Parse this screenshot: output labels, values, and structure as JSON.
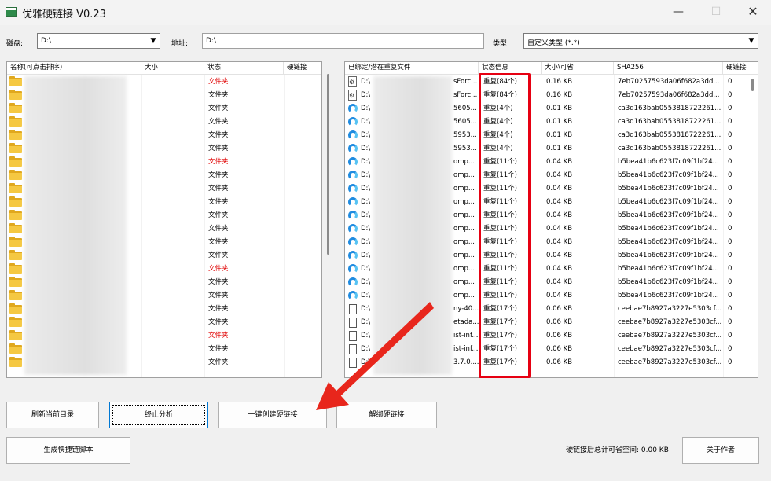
{
  "window": {
    "title": "优雅硬链接 V0.23",
    "controls": [
      "—",
      "☐",
      "✕"
    ]
  },
  "toolbar": {
    "disk_label": "磁盘:",
    "disk_value": "D:\\",
    "address_label": "地址:",
    "address_value": "D:\\",
    "type_label": "类型:",
    "type_value": "自定义类型 (*.*)"
  },
  "left_table": {
    "columns": [
      "名称(可点击排序)",
      "大小",
      "状态",
      "硬链接"
    ],
    "rows": [
      {
        "status": "文件夹",
        "red": true
      },
      {
        "status": "文件夹",
        "red": false
      },
      {
        "status": "文件夹",
        "red": false
      },
      {
        "status": "文件夹",
        "red": false
      },
      {
        "status": "文件夹",
        "red": false
      },
      {
        "status": "文件夹",
        "red": false
      },
      {
        "status": "文件夹",
        "red": true
      },
      {
        "status": "文件夹",
        "red": false
      },
      {
        "status": "文件夹",
        "red": false
      },
      {
        "status": "文件夹",
        "red": false
      },
      {
        "status": "文件夹",
        "red": false
      },
      {
        "status": "文件夹",
        "red": false
      },
      {
        "status": "文件夹",
        "red": false
      },
      {
        "status": "文件夹",
        "red": false
      },
      {
        "status": "文件夹",
        "red": true
      },
      {
        "status": "文件夹",
        "red": false
      },
      {
        "status": "文件夹",
        "red": false
      },
      {
        "status": "文件夹",
        "red": false
      },
      {
        "status": "文件夹",
        "red": false
      },
      {
        "status": "文件夹",
        "red": true
      },
      {
        "status": "文件夹",
        "red": false
      },
      {
        "status": "文件夹",
        "red": false
      }
    ]
  },
  "right_table": {
    "columns": [
      "已绑定/潜在重复文件",
      "状态信息",
      "大小\\可省",
      "SHA256",
      "硬链接"
    ],
    "rows": [
      {
        "icon": "gear-file-icon",
        "path": "D:\\",
        "tail": "sForc...",
        "status": "重复(84个)",
        "size": "0.16 KB",
        "sha": "7eb70257593da06f682a3dd...",
        "link": "0"
      },
      {
        "icon": "gear-file-icon",
        "path": "D:\\",
        "tail": "sForc...",
        "status": "重复(84个)",
        "size": "0.16 KB",
        "sha": "7eb70257593da06f682a3dd...",
        "link": "0"
      },
      {
        "icon": "edge-icon",
        "path": "D:\\",
        "tail": "5605...",
        "status": "重复(4个)",
        "size": "0.01 KB",
        "sha": "ca3d163bab0553818722261...",
        "link": "0"
      },
      {
        "icon": "edge-icon",
        "path": "D:\\",
        "tail": "5605...",
        "status": "重复(4个)",
        "size": "0.01 KB",
        "sha": "ca3d163bab0553818722261...",
        "link": "0"
      },
      {
        "icon": "edge-icon",
        "path": "D:\\",
        "tail": "5953...",
        "status": "重复(4个)",
        "size": "0.01 KB",
        "sha": "ca3d163bab0553818722261...",
        "link": "0"
      },
      {
        "icon": "edge-icon",
        "path": "D:\\",
        "tail": "5953...",
        "status": "重复(4个)",
        "size": "0.01 KB",
        "sha": "ca3d163bab0553818722261...",
        "link": "0"
      },
      {
        "icon": "edge-icon",
        "path": "D:\\",
        "tail": "omp...",
        "status": "重复(11个)",
        "size": "0.04 KB",
        "sha": "b5bea41b6c623f7c09f1bf24...",
        "link": "0"
      },
      {
        "icon": "edge-icon",
        "path": "D:\\",
        "tail": "omp...",
        "status": "重复(11个)",
        "size": "0.04 KB",
        "sha": "b5bea41b6c623f7c09f1bf24...",
        "link": "0"
      },
      {
        "icon": "edge-icon",
        "path": "D:\\",
        "tail": "omp...",
        "status": "重复(11个)",
        "size": "0.04 KB",
        "sha": "b5bea41b6c623f7c09f1bf24...",
        "link": "0"
      },
      {
        "icon": "edge-icon",
        "path": "D:\\",
        "tail": "omp...",
        "status": "重复(11个)",
        "size": "0.04 KB",
        "sha": "b5bea41b6c623f7c09f1bf24...",
        "link": "0"
      },
      {
        "icon": "edge-icon",
        "path": "D:\\",
        "tail": "omp...",
        "status": "重复(11个)",
        "size": "0.04 KB",
        "sha": "b5bea41b6c623f7c09f1bf24...",
        "link": "0"
      },
      {
        "icon": "edge-icon",
        "path": "D:\\",
        "tail": "omp...",
        "status": "重复(11个)",
        "size": "0.04 KB",
        "sha": "b5bea41b6c623f7c09f1bf24...",
        "link": "0"
      },
      {
        "icon": "edge-icon",
        "path": "D:\\",
        "tail": "omp...",
        "status": "重复(11个)",
        "size": "0.04 KB",
        "sha": "b5bea41b6c623f7c09f1bf24...",
        "link": "0"
      },
      {
        "icon": "edge-icon",
        "path": "D:\\",
        "tail": "omp...",
        "status": "重复(11个)",
        "size": "0.04 KB",
        "sha": "b5bea41b6c623f7c09f1bf24...",
        "link": "0"
      },
      {
        "icon": "edge-icon",
        "path": "D:\\",
        "tail": "omp...",
        "status": "重复(11个)",
        "size": "0.04 KB",
        "sha": "b5bea41b6c623f7c09f1bf24...",
        "link": "0"
      },
      {
        "icon": "edge-icon",
        "path": "D:\\",
        "tail": "omp...",
        "status": "重复(11个)",
        "size": "0.04 KB",
        "sha": "b5bea41b6c623f7c09f1bf24...",
        "link": "0"
      },
      {
        "icon": "edge-icon",
        "path": "D:\\",
        "tail": "omp...",
        "status": "重复(11个)",
        "size": "0.04 KB",
        "sha": "b5bea41b6c623f7c09f1bf24...",
        "link": "0"
      },
      {
        "icon": "file-icon",
        "path": "D:\\",
        "tail": "ny-40...",
        "status": "重复(17个)",
        "size": "0.06 KB",
        "sha": "ceebae7b8927a3227e5303cf...",
        "link": "0"
      },
      {
        "icon": "file-icon",
        "path": "D:\\",
        "tail": "etada...",
        "status": "重复(17个)",
        "size": "0.06 KB",
        "sha": "ceebae7b8927a3227e5303cf...",
        "link": "0"
      },
      {
        "icon": "file-icon",
        "path": "D:\\",
        "tail": "ist-inf...",
        "status": "重复(17个)",
        "size": "0.06 KB",
        "sha": "ceebae7b8927a3227e5303cf...",
        "link": "0"
      },
      {
        "icon": "file-icon",
        "path": "D:\\",
        "tail": "ist-inf...",
        "status": "重复(17个)",
        "size": "0.06 KB",
        "sha": "ceebae7b8927a3227e5303cf...",
        "link": "0"
      },
      {
        "icon": "file-icon",
        "path": "D:\\",
        "tail": "3.7.0....",
        "status": "重复(17个)",
        "size": "0.06 KB",
        "sha": "ceebae7b8927a3227e5303cf...",
        "link": "0"
      }
    ]
  },
  "buttons": {
    "refresh": "刷新当前目录",
    "stop": "终止分析",
    "create": "一键创建硬链接",
    "unbind": "解绑硬链接",
    "script": "生成快捷链脚本",
    "about": "关于作者"
  },
  "status": {
    "saved_space": "硬链接后总计可省空间: 0.00 KB"
  },
  "colors": {
    "highlight_box": "#e60012",
    "annotation_arrow": "#e8261c",
    "red_status": "#e00000"
  }
}
